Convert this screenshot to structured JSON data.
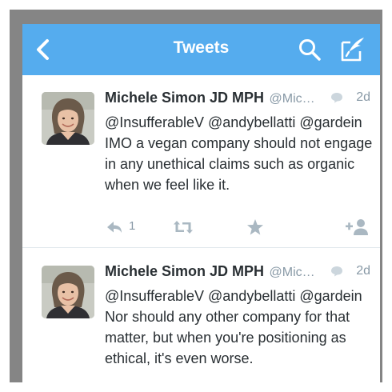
{
  "nav": {
    "title": "Tweets",
    "background_color": "#55acee",
    "icons": [
      "chevron-left-icon",
      "search-icon",
      "compose-icon"
    ]
  },
  "tweets": [
    {
      "author": "Michele Simon JD MPH",
      "handle": "@Mic…",
      "time": "2d",
      "text": "@InsufferableV @andybellatti @gardein IMO a vegan company should not engage in any unethical claims such as organic when we feel like it.",
      "reply_count": "1"
    },
    {
      "author": "Michele Simon JD MPH",
      "handle": "@Mic…",
      "time": "2d",
      "text": "@InsufferableV @andybellatti @gardein Nor should any other company for that matter, but when you're positioning as ethical, it's even worse."
    }
  ],
  "colors": {
    "text": "#292f33",
    "muted": "#8899a6",
    "action_icons": "#aab8c2",
    "divider": "#e1e8ed"
  }
}
